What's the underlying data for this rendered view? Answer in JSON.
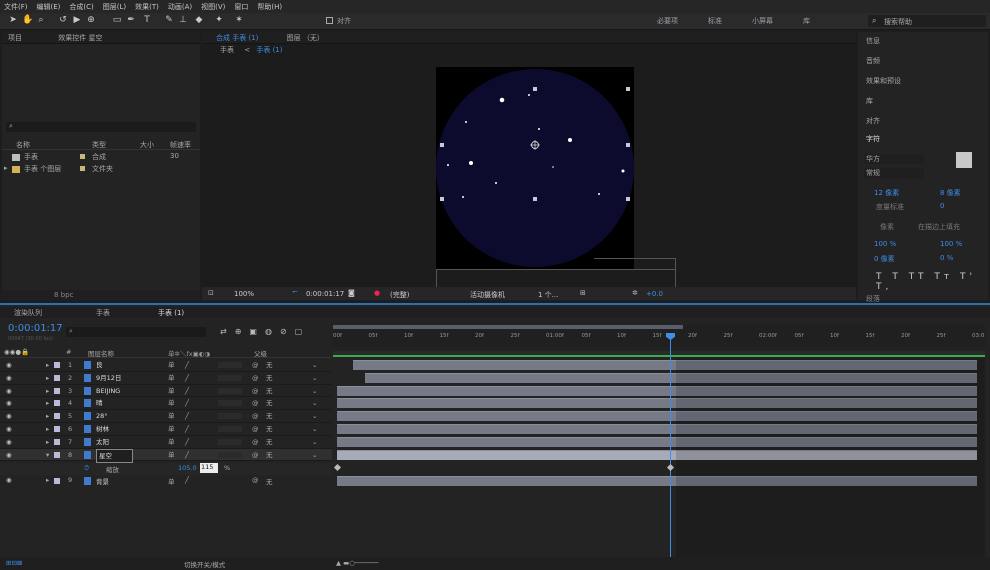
{
  "menu": [
    "文件(F)",
    "编辑(E)",
    "合成(C)",
    "图层(L)",
    "效果(T)",
    "动画(A)",
    "视图(V)",
    "窗口",
    "帮助(H)"
  ],
  "toolbar": {
    "snap_label": "对齐",
    "workspaces": [
      "必要项",
      "标准",
      "小屏幕",
      "库"
    ],
    "search_placeholder": "搜索帮助"
  },
  "project": {
    "tab_label": "项目",
    "effects_tab_label": "效果控件 星空",
    "columns": [
      "名称",
      "类型",
      "大小",
      "帧速率"
    ],
    "items": [
      {
        "name": "手表",
        "type": "合成",
        "rate": "30"
      },
      {
        "name": "手表 个图层",
        "type": "文件夹",
        "rate": ""
      }
    ],
    "bpc": "8 bpc"
  },
  "comp": {
    "tab_label": "合成 手表 (1)",
    "layer_tab_label": "图层 （无）",
    "breadcrumb_root": "手表",
    "breadcrumb_active": "手表 (1)",
    "zoom": "100%",
    "timecode": "0:00:01:17",
    "resolution": "(完整)",
    "camera": "活动摄像机",
    "views": "1 个...",
    "exposure": "+0.0"
  },
  "right_panel": {
    "items": [
      "信息",
      "音频",
      "效果和预设",
      "库",
      "对齐"
    ],
    "char_title": "字符",
    "font_family": "华方",
    "font_style": "常规",
    "font_size": "12 像素",
    "leading": "8 像素",
    "tracking_unit": "度量标准",
    "tracking": "0",
    "stroke": "像素",
    "stroke_mode": "在描边上填充",
    "vscale": "100 %",
    "hscale": "100 %",
    "baseline": "0 像素",
    "tsume": "0 %",
    "paragraph": "段落"
  },
  "timeline": {
    "tabs": [
      "渲染队列",
      "手表",
      "手表 (1)"
    ],
    "timecode": "0:00:01:17",
    "timecode_sub": "00047 (30.00 fps)",
    "col_name": "图层名称",
    "col_parent": "父级",
    "ruler": [
      "00f",
      "05f",
      "10f",
      "15f",
      "20f",
      "25f",
      "01:00f",
      "05f",
      "10f",
      "15f",
      "20f",
      "25f",
      "02:00f",
      "05f",
      "10f",
      "15f",
      "20f",
      "25f",
      "03:0"
    ],
    "layers": [
      {
        "num": "1",
        "name": "良",
        "parent": "无"
      },
      {
        "num": "2",
        "name": "9月12日",
        "parent": "无"
      },
      {
        "num": "3",
        "name": "BEIJING",
        "parent": "无"
      },
      {
        "num": "4",
        "name": "晴",
        "parent": "无"
      },
      {
        "num": "5",
        "name": "28°",
        "parent": "无"
      },
      {
        "num": "6",
        "name": "树林",
        "parent": "无"
      },
      {
        "num": "7",
        "name": "太阳",
        "parent": "无"
      },
      {
        "num": "8",
        "name": "星空",
        "parent": "无"
      }
    ],
    "scale_label": "缩放",
    "scale_x": "105.0",
    "scale_y": "115",
    "scale_unit": "%",
    "last_layer": {
      "num": "9",
      "name": "背景",
      "parent": "无"
    },
    "footer": "切换开关/模式"
  },
  "colors": {
    "accent": "#2d8ceb",
    "circle": "#0c0b2e",
    "bar": "#757a86",
    "selected_bar": "#a7abb8",
    "green": "#3bab4f"
  }
}
